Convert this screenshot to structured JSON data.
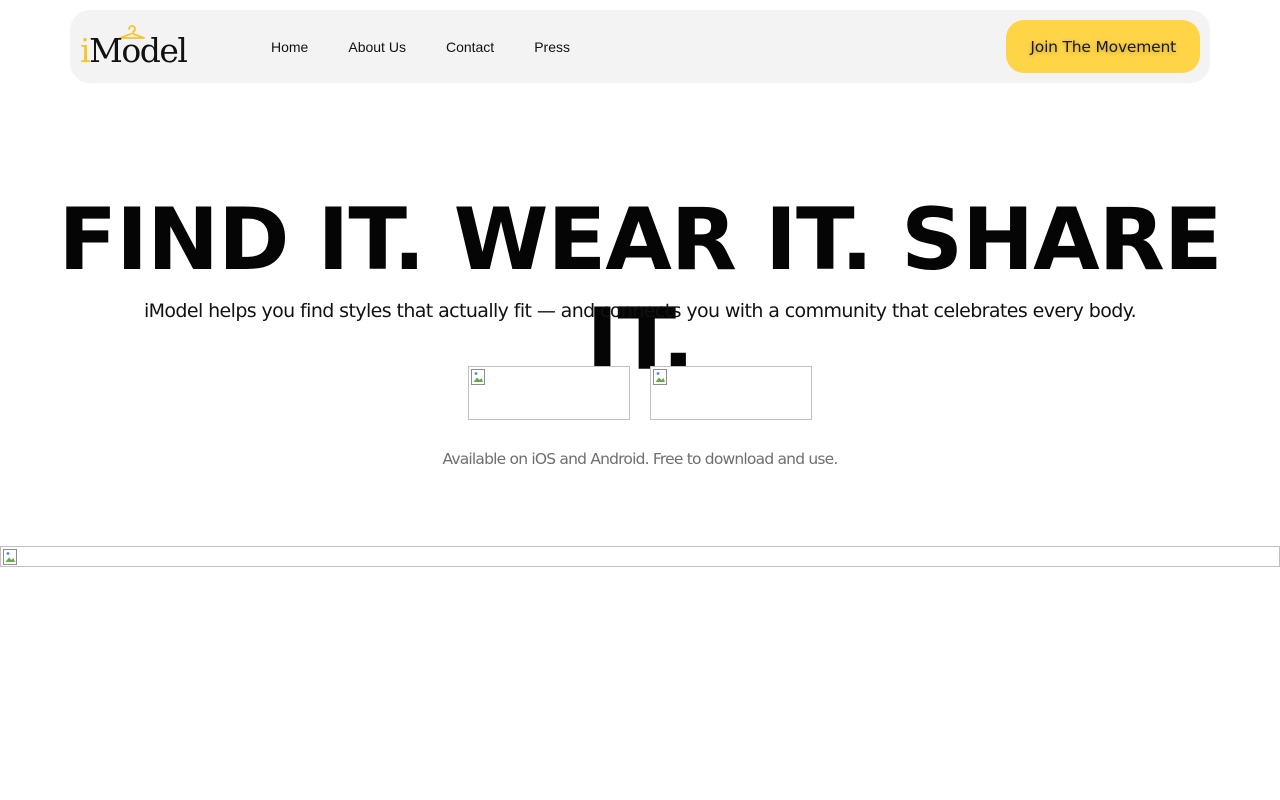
{
  "header": {
    "logo": {
      "icon": "hanger-icon",
      "text_first": "i",
      "text_rest": "Model",
      "accent_color": "#f7c52b"
    },
    "nav": [
      {
        "label": "Home"
      },
      {
        "label": "About Us"
      },
      {
        "label": "Contact"
      },
      {
        "label": "Press"
      }
    ],
    "cta_label": "Join The Movement",
    "cta_color": "#ffd446",
    "bar_color": "#f3f3f3"
  },
  "hero": {
    "title": "FIND IT. WEAR IT. SHARE IT.",
    "subtitle": "iModel helps you find styles that actually fit — and connects you with a community that celebrates every body.",
    "store_badges": [
      {
        "icon": "broken-image-icon"
      },
      {
        "icon": "broken-image-icon"
      }
    ],
    "availability": "Available on iOS and Android. Free to download and use."
  },
  "banner": {
    "icon": "broken-image-icon"
  }
}
